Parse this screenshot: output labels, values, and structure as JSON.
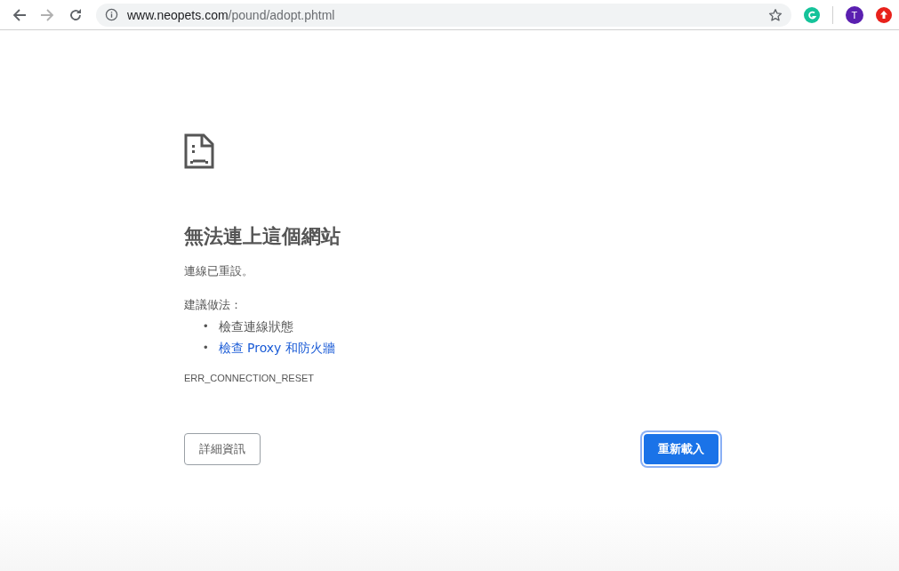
{
  "toolbar": {
    "url": {
      "host": "www.neopets.com",
      "path": "/pound/adopt.phtml"
    },
    "back_disabled": false,
    "forward_disabled": true,
    "extensions": [
      {
        "kind": "grammar"
      },
      {
        "kind": "divider"
      },
      {
        "kind": "avatar",
        "label": "T"
      },
      {
        "kind": "upload"
      }
    ]
  },
  "error": {
    "title": "無法連上這個網站",
    "message": "連線已重設。",
    "suggestions_label": "建議做法：",
    "suggestions": [
      {
        "bullet": "•",
        "text": "檢查連線狀態",
        "link": false
      },
      {
        "bullet": "•",
        "text": "檢查 Proxy 和防火牆",
        "link": true
      }
    ],
    "code": "ERR_CONNECTION_RESET"
  },
  "buttons": {
    "details": "詳細資訊",
    "reload": "重新載入"
  }
}
